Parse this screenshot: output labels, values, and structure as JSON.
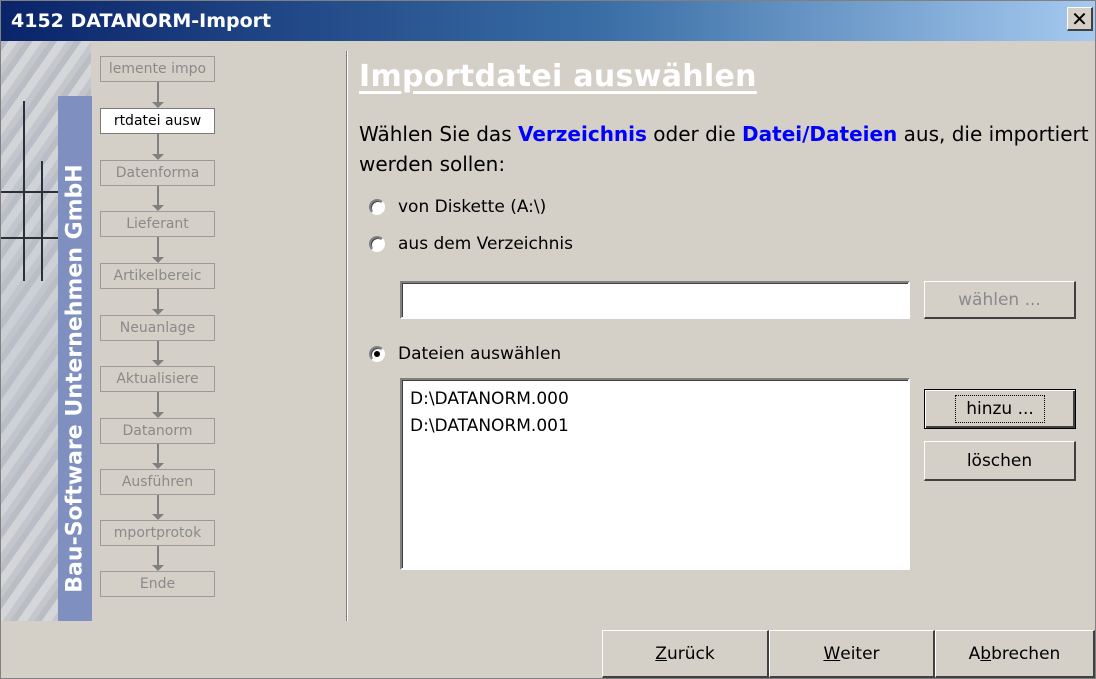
{
  "window": {
    "title": "4152 DATANORM-Import",
    "close_glyph": "✕"
  },
  "sidebar": {
    "vertical_text": "Bau-Software Unternehmen GmbH",
    "steps": [
      {
        "label": "lemente impo",
        "active": false
      },
      {
        "label": "rtdatei ausw",
        "active": true
      },
      {
        "label": "Datenforma",
        "active": false
      },
      {
        "label": "Lieferant",
        "active": false
      },
      {
        "label": "Artikelbereic",
        "active": false
      },
      {
        "label": "Neuanlage",
        "active": false
      },
      {
        "label": "Aktualisiere",
        "active": false
      },
      {
        "label": "Datanorm",
        "active": false
      },
      {
        "label": "Ausführen",
        "active": false
      },
      {
        "label": "mportprotok",
        "active": false
      },
      {
        "label": "Ende",
        "active": false
      }
    ]
  },
  "main": {
    "heading": "Importdatei auswählen",
    "instruction": {
      "p1": "Wählen Sie das ",
      "h1": "Verzeichnis",
      "p2": " oder die ",
      "h2": "Datei/Dateien",
      "p3": " aus, die importiert werden sollen:"
    },
    "options": [
      {
        "label": "von Diskette (A:\\)",
        "checked": false
      },
      {
        "label": "aus dem Verzeichnis",
        "checked": false
      },
      {
        "label": "Dateien auswählen",
        "checked": true
      }
    ],
    "directory_value": "",
    "choose_button": "wählen ...",
    "files": [
      "D:\\DATANORM.000",
      "D:\\DATANORM.001"
    ],
    "add_button": "hinzu ...",
    "delete_button": "löschen"
  },
  "footer": {
    "back": {
      "before": "",
      "mnemonic": "Z",
      "after": "urück"
    },
    "next": {
      "before": "",
      "mnemonic": "W",
      "after": "eiter"
    },
    "cancel": {
      "before": "A",
      "mnemonic": "b",
      "after": "brechen"
    }
  },
  "colors": {
    "titlebar_start": "#0a246a",
    "titlebar_end": "#a6caf0",
    "face": "#d4d0c8",
    "highlight_text": "#0000ff",
    "band": "#7f8fbf"
  }
}
